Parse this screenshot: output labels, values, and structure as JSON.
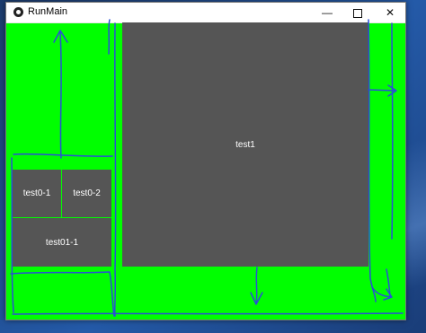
{
  "window": {
    "title": "RunMain",
    "controls": {
      "minimize": "—",
      "maximize": "",
      "close": "✕"
    }
  },
  "cells": {
    "test1": "test1",
    "test0_1": "test0-1",
    "test0_2": "test0-2",
    "test01_1": "test01-1"
  },
  "colors": {
    "client_background": "#00ff00",
    "cell_background": "#555555",
    "sketch_stroke": "#2a4fd6"
  },
  "icons": [
    "app-icon",
    "minimize-icon",
    "maximize-icon",
    "close-icon",
    "arrow-up-icon",
    "arrow-right-icon",
    "arrow-down-icon"
  ]
}
